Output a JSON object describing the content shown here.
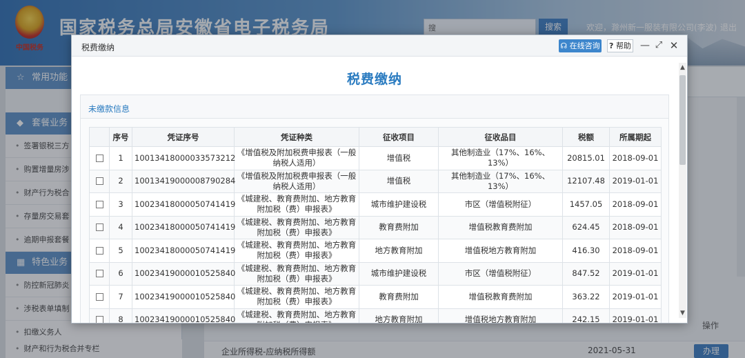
{
  "background": {
    "site_title": "国家税务总局安徽省电子税务局",
    "emblem_sub": "中国税务",
    "search_placeholder": "搜",
    "search_button": "搜索",
    "user_text": "欢迎，滁州新一服装有限公司(李波)",
    "logout": "退出",
    "sidebar": {
      "common": "常用功能",
      "package": "套餐业务",
      "package_items": [
        "签署银税三方",
        "购置增量房涉",
        "财产行为税合",
        "存量房交易套",
        "逾期申报套餐"
      ],
      "special": "特色业务",
      "special_items": [
        "防控新冠肺炎",
        "涉税表单填制",
        "扣缴义务人"
      ],
      "bottom_item": "财产和行为税合并专栏"
    },
    "main": {
      "op_header": "操作",
      "row_name": "企业所得税-应纳税所得额",
      "row_date": "2021-05-31",
      "row_button": "办理"
    }
  },
  "modal": {
    "title": "税费缴纳",
    "online_button": "在线咨询",
    "help_button": "帮助",
    "heading": "税费缴纳",
    "panel_title": "未缴款信息",
    "table": {
      "headers": [
        "",
        "序号",
        "凭证序号",
        "凭证种类",
        "征收项目",
        "征收品目",
        "税额",
        "所属期起"
      ],
      "rows": [
        {
          "no": "1",
          "voucher": "10013418000033573212",
          "type": "《增值税及附加税费申报表（一般纳税人适用）",
          "item": "增值税",
          "sub": "其他制造业（17%、16%、13%）",
          "amount": "20815.01",
          "period": "2018-09-01"
        },
        {
          "no": "2",
          "voucher": "10013419000008790284",
          "type": "《增值税及附加税费申报表（一般纳税人适用）",
          "item": "增值税",
          "sub": "其他制造业（17%、16%、13%）",
          "amount": "12107.48",
          "period": "2019-01-01"
        },
        {
          "no": "3",
          "voucher": "10023418000050741419",
          "type": "《城建税、教育费附加、地方教育附加税（费）申报表》",
          "item": "城市维护建设税",
          "sub": "市区（增值税附征）",
          "amount": "1457.05",
          "period": "2018-09-01"
        },
        {
          "no": "4",
          "voucher": "10023418000050741419",
          "type": "《城建税、教育费附加、地方教育附加税（费）申报表》",
          "item": "教育费附加",
          "sub": "增值税教育费附加",
          "amount": "624.45",
          "period": "2018-09-01"
        },
        {
          "no": "5",
          "voucher": "10023418000050741419",
          "type": "《城建税、教育费附加、地方教育附加税（费）申报表》",
          "item": "地方教育附加",
          "sub": "增值税地方教育附加",
          "amount": "416.30",
          "period": "2018-09-01"
        },
        {
          "no": "6",
          "voucher": "10023419000010525840",
          "type": "《城建税、教育费附加、地方教育附加税（费）申报表》",
          "item": "城市维护建设税",
          "sub": "市区（增值税附征）",
          "amount": "847.52",
          "period": "2019-01-01"
        },
        {
          "no": "7",
          "voucher": "10023419000010525840",
          "type": "《城建税、教育费附加、地方教育附加税（费）申报表》",
          "item": "教育费附加",
          "sub": "增值税教育费附加",
          "amount": "363.22",
          "period": "2019-01-01"
        },
        {
          "no": "8",
          "voucher": "10023419000010525840",
          "type": "《城建税、教育费附加、地方教育附加税（费）申报表》",
          "item": "地方教育附加",
          "sub": "增值税地方教育附加",
          "amount": "242.15",
          "period": "2019-01-01"
        }
      ]
    }
  }
}
